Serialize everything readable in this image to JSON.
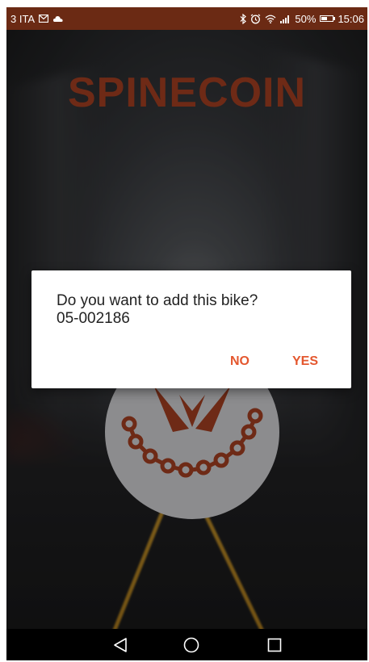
{
  "status_bar": {
    "carrier": "3 ITA",
    "battery_text": "50%",
    "battery_level": 0.5,
    "time": "15:06",
    "icons": [
      "mail-icon",
      "cloud-icon",
      "bluetooth-icon",
      "alarm-icon",
      "wifi-icon",
      "signal-icon",
      "battery-icon"
    ]
  },
  "app": {
    "title": "SPINECOIN",
    "title_color": "#6e2a16",
    "logo_icon": "bike-chain-logo-icon"
  },
  "dialog": {
    "message_line1": "Do you want to add this bike?",
    "message_line2": "05-002186",
    "no_label": "NO",
    "yes_label": "YES",
    "accent_color": "#e4572e"
  },
  "nav_bar": {
    "icons": [
      "back-icon",
      "home-icon",
      "recents-icon"
    ]
  }
}
